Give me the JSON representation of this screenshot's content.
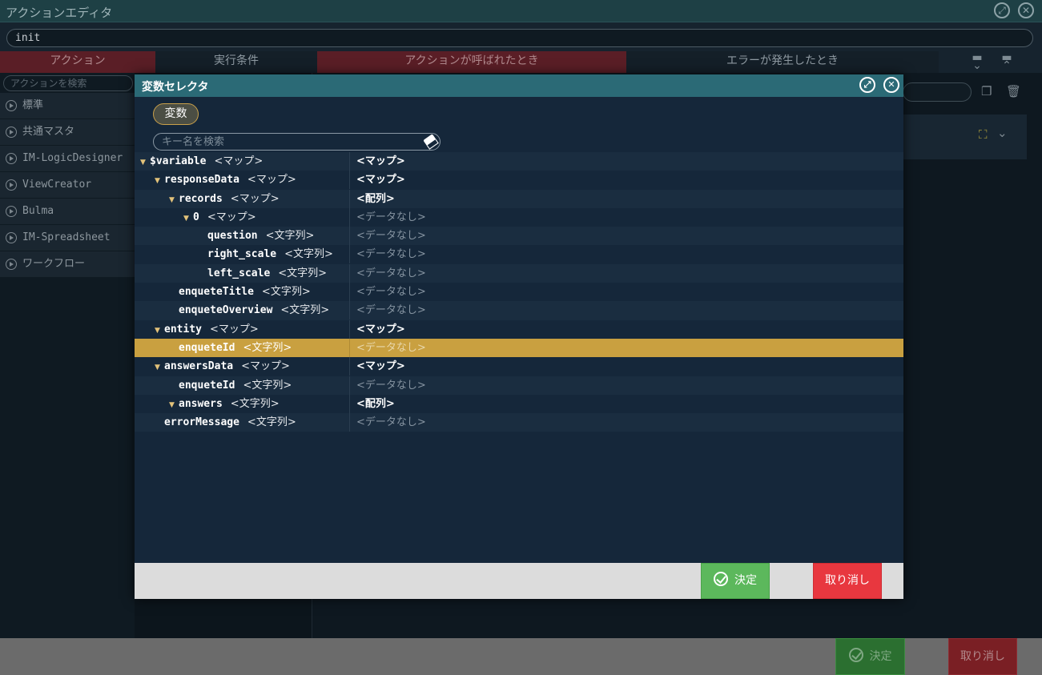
{
  "editor": {
    "title": "アクションエディタ",
    "action_name": "init",
    "tabs": [
      "アクション",
      "実行条件",
      "アクションが呼ばれたとき",
      "エラーが発生したとき"
    ],
    "search_placeholder": "アクションを検索",
    "categories": [
      "標準",
      "共通マスタ",
      "IM-LogicDesigner",
      "ViewCreator",
      "Bulma",
      "IM-Spreadsheet",
      "ワークフロー"
    ],
    "ok_label": "決定",
    "cancel_label": "取り消し"
  },
  "modal": {
    "title": "変数セレクタ",
    "tab_label": "変数",
    "search_placeholder": "キー名を検索",
    "ok_label": "決定",
    "cancel_label": "取り消し",
    "rows": [
      {
        "key": "$variable",
        "type": "<マップ>",
        "value": "<マップ>",
        "depth": 0,
        "expandable": true
      },
      {
        "key": "responseData",
        "type": "<マップ>",
        "value": "<マップ>",
        "depth": 1,
        "expandable": true
      },
      {
        "key": "records",
        "type": "<マップ>",
        "value": "<配列>",
        "depth": 2,
        "expandable": true
      },
      {
        "key": "0",
        "type": "<マップ>",
        "value": "<データなし>",
        "depth": 3,
        "expandable": true
      },
      {
        "key": "question",
        "type": "<文字列>",
        "value": "<データなし>",
        "depth": 4,
        "expandable": false
      },
      {
        "key": "right_scale",
        "type": "<文字列>",
        "value": "<データなし>",
        "depth": 4,
        "expandable": false
      },
      {
        "key": "left_scale",
        "type": "<文字列>",
        "value": "<データなし>",
        "depth": 4,
        "expandable": false
      },
      {
        "key": "enqueteTitle",
        "type": "<文字列>",
        "value": "<データなし>",
        "depth": 2,
        "expandable": false
      },
      {
        "key": "enqueteOverview",
        "type": "<文字列>",
        "value": "<データなし>",
        "depth": 2,
        "expandable": false
      },
      {
        "key": "entity",
        "type": "<マップ>",
        "value": "<マップ>",
        "depth": 1,
        "expandable": true
      },
      {
        "key": "enqueteId",
        "type": "<文字列>",
        "value": "<データなし>",
        "depth": 2,
        "expandable": false,
        "selected": true
      },
      {
        "key": "answersData",
        "type": "<マップ>",
        "value": "<マップ>",
        "depth": 1,
        "expandable": true
      },
      {
        "key": "enqueteId",
        "type": "<文字列>",
        "value": "<データなし>",
        "depth": 2,
        "expandable": false
      },
      {
        "key": "answers",
        "type": "<文字列>",
        "value": "<配列>",
        "depth": 2,
        "expandable": true
      },
      {
        "key": "errorMessage",
        "type": "<文字列>",
        "value": "<データなし>",
        "depth": 1,
        "expandable": false
      }
    ]
  },
  "colors": {
    "modal_header": "#2b6a76",
    "selected_row": "#c9a040",
    "ok_button": "#5cb85c",
    "cancel_button": "#e8373f"
  }
}
